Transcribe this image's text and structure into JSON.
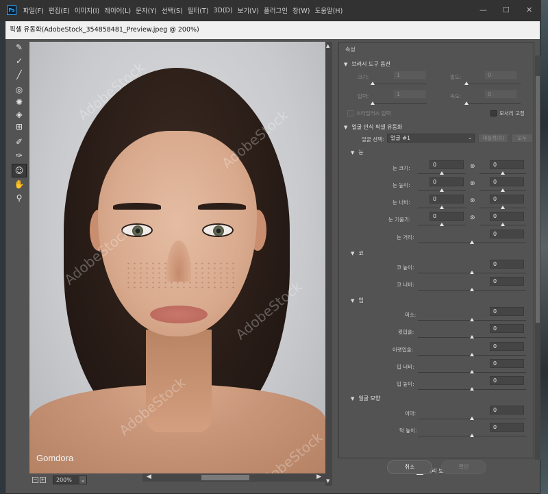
{
  "app": {
    "menu": [
      "파일(F)",
      "편집(E)",
      "이미지(I)",
      "레이어(L)",
      "문자(Y)",
      "선택(S)",
      "필터(T)",
      "3D(D)",
      "보기(V)",
      "플러그인",
      "창(W)",
      "도움말(H)"
    ],
    "logo": "Ps"
  },
  "dialog": {
    "title": "픽셀 유동화(AdobeStock_354858481_Preview.jpeg @ 200%)",
    "zoom": "200%",
    "image_credit": "Gomdora",
    "watermark": "AdobeStock"
  },
  "panel": {
    "header": "속성",
    "brush_section": {
      "title": "브러시 도구 옵션",
      "size_label": "크기:",
      "size_value": "1",
      "density_label": "밀도:",
      "density_value": "0",
      "pressure_label": "압력:",
      "pressure_value": "1",
      "rate_label": "속도:",
      "rate_value": "0",
      "stylus_label": "스타일러스 압력",
      "pin_edges_label": "모서리 고정"
    },
    "face_section": {
      "title": "얼굴 인식 픽셀 유동화",
      "select_label": "얼굴 선택:",
      "select_value": "얼굴 #1",
      "reset_label": "재설정(R)",
      "all_label": "모두"
    },
    "eyes": {
      "title": "눈",
      "rows": [
        {
          "label": "눈 크기:",
          "left": "0",
          "right": "0"
        },
        {
          "label": "눈 높이:",
          "left": "0",
          "right": "0"
        },
        {
          "label": "눈 너비:",
          "left": "0",
          "right": "0"
        },
        {
          "label": "눈 기울기:",
          "left": "0",
          "right": "0"
        },
        {
          "label": "눈 거리:",
          "value": "0"
        }
      ]
    },
    "nose": {
      "title": "코",
      "rows": [
        {
          "label": "코 높이:",
          "value": "0"
        },
        {
          "label": "코 너비:",
          "value": "0"
        }
      ]
    },
    "mouth": {
      "title": "입",
      "rows": [
        {
          "label": "미소:",
          "value": "0"
        },
        {
          "label": "윗입술:",
          "value": "0"
        },
        {
          "label": "아랫입술:",
          "value": "0"
        },
        {
          "label": "입 너비:",
          "value": "0"
        },
        {
          "label": "입 높이:",
          "value": "0"
        }
      ]
    },
    "face_shape": {
      "title": "얼굴 모양",
      "rows": [
        {
          "label": "이마:",
          "value": "0"
        },
        {
          "label": "턱 높이:",
          "value": "0"
        }
      ]
    }
  },
  "footer": {
    "preview_label": "미리 보기(P)",
    "cancel_label": "취소",
    "ok_label": "확인"
  }
}
